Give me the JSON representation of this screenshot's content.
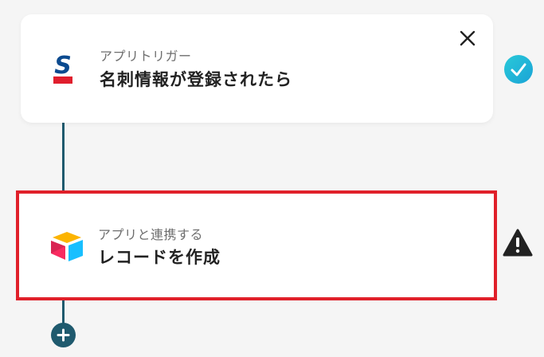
{
  "steps": [
    {
      "app_icon": "sansan-logo-icon",
      "subtitle": "アプリトリガー",
      "title": "名刺情報が登録されたら",
      "status": "success",
      "status_icon": "check-circle-icon",
      "status_color": "#29c9d9"
    },
    {
      "app_icon": "airtable-logo-icon",
      "subtitle": "アプリと連携する",
      "title": "レコードを作成",
      "status": "warning",
      "status_icon": "warning-triangle-icon",
      "status_color": "#222222",
      "highlight_color": "#e0202a"
    }
  ],
  "connector_color": "#1f5a6e",
  "add_step_icon": "plus-icon"
}
